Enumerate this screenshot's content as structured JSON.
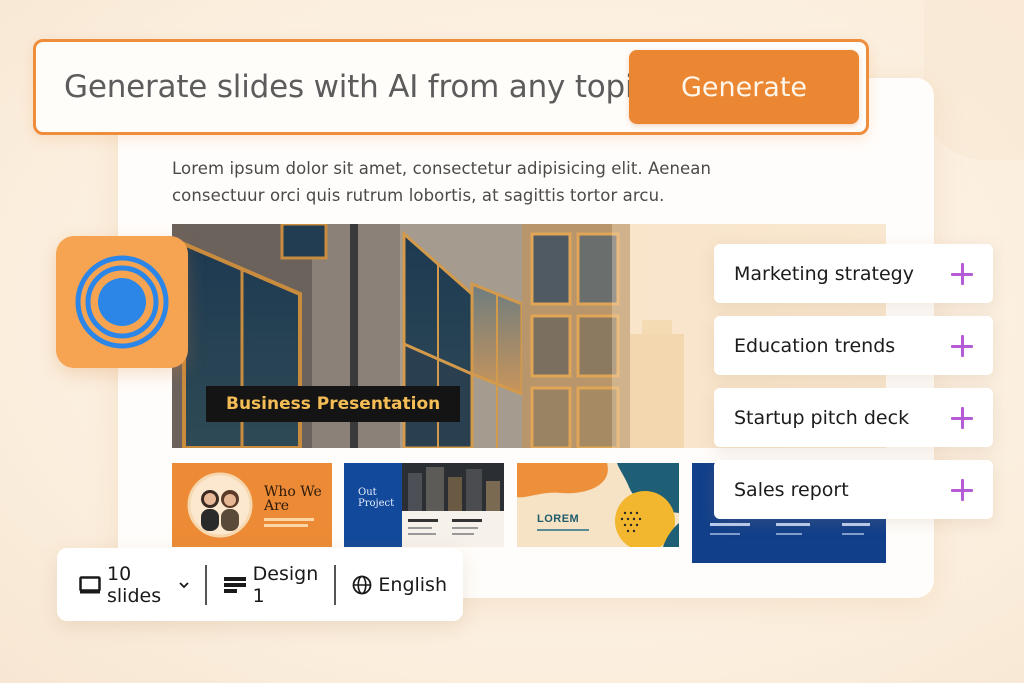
{
  "prompt": {
    "placeholder": "Generate slides with AI from any topic",
    "button_label": "Generate"
  },
  "description": "Lorem ipsum dolor sit amet, consectetur adipisicing elit. Aenean consectuur orci quis rutrum lobortis, at sagittis tortor arcu.",
  "hero": {
    "caption": "Business Presentation"
  },
  "logo": {
    "icon": "concentric-circles-icon",
    "bg_color": "#f6a451",
    "icon_color": "#2b86e8"
  },
  "thumbnails": [
    {
      "title": "Who We Are"
    },
    {
      "title": "Out Project"
    },
    {
      "title": "LOREM"
    },
    {
      "title": ""
    }
  ],
  "topics": [
    {
      "label": "Marketing strategy",
      "icon": "plus-icon"
    },
    {
      "label": "Education trends",
      "icon": "plus-icon"
    },
    {
      "label": "Startup pitch deck",
      "icon": "plus-icon"
    },
    {
      "label": "Sales report",
      "icon": "plus-icon"
    }
  ],
  "options": {
    "slides": {
      "label": "10 slides",
      "icon": "monitor-icon"
    },
    "design": {
      "label": "Design 1",
      "icon": "layout-icon"
    },
    "language": {
      "label": "English",
      "icon": "globe-icon"
    }
  },
  "colors": {
    "accent": "#eb8632",
    "plus": "#b65bd6",
    "caption_text": "#f4bd55"
  }
}
